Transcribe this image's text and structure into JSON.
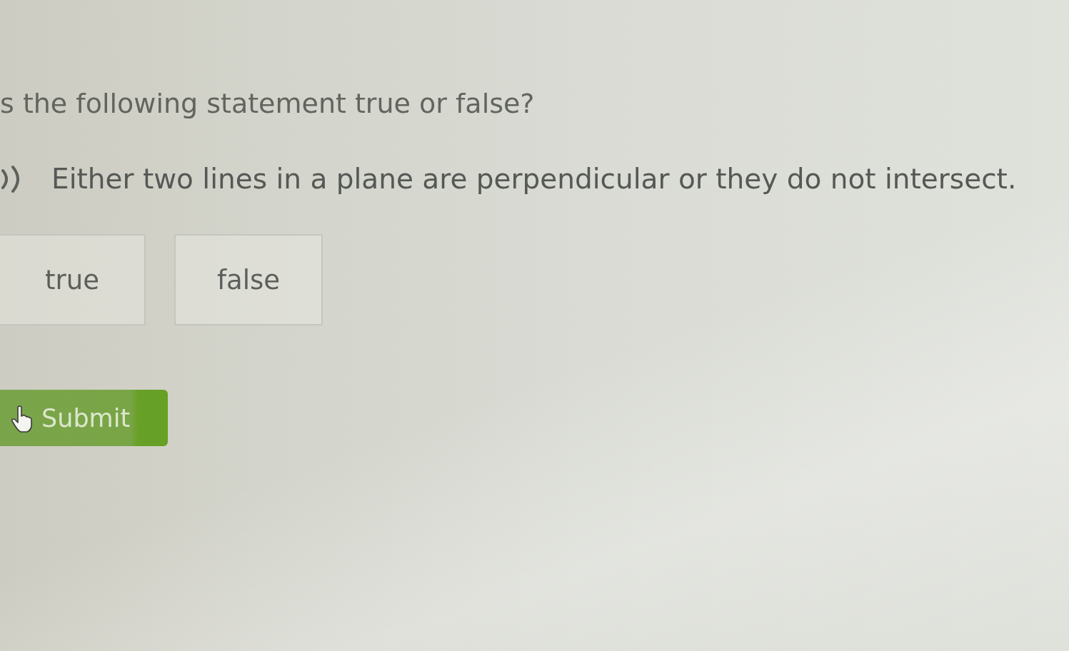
{
  "question": {
    "prompt": "s the following statement true or false?",
    "statement": "Either two lines in a plane are perpendicular or they do not intersect."
  },
  "choices": [
    {
      "label": "true",
      "selected": false
    },
    {
      "label": "false",
      "selected": false
    }
  ],
  "submit_button": {
    "label": "Submit"
  }
}
